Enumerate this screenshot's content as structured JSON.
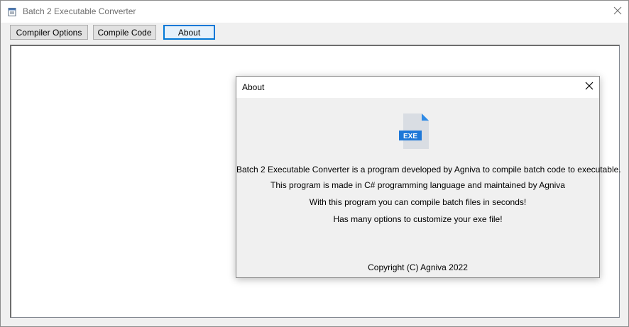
{
  "window": {
    "title": "Batch 2 Executable Converter"
  },
  "toolbar": {
    "compiler_options_label": "Compiler Options",
    "compile_code_label": "Compile Code",
    "about_label": "About"
  },
  "about_dialog": {
    "title": "About",
    "icon_label": "EXE",
    "lines": [
      "Batch 2 Executable Converter is a program developed by Agniva to compile batch code to executable.",
      "This program is made in C# programming language and maintained by Agniva",
      "With this program you can compile batch files in seconds!",
      "Has many options to customize your exe file!"
    ],
    "copyright": "Copyright (C) Agniva 2022"
  },
  "colors": {
    "accent": "#0078d7",
    "window_bg": "#f0f0f0",
    "exe_badge": "#1e78d8"
  },
  "icons": {
    "app": "batch-file-icon",
    "close": "close-icon",
    "exe": "exe-file-icon"
  }
}
